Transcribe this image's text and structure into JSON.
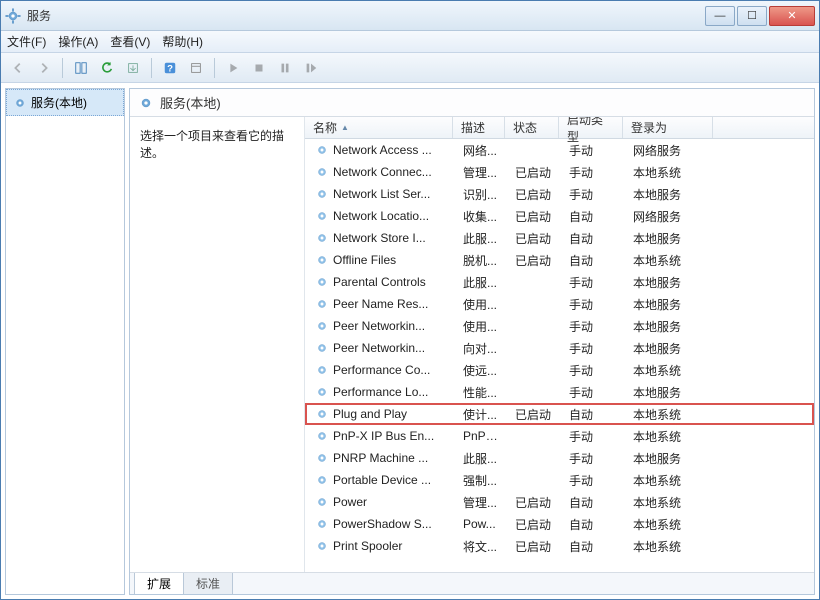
{
  "window": {
    "title": "服务"
  },
  "menu": {
    "file": "文件(F)",
    "action": "操作(A)",
    "view": "查看(V)",
    "help": "帮助(H)"
  },
  "tree": {
    "root": "服务(本地)"
  },
  "pane": {
    "header": "服务(本地)",
    "desc_hint": "选择一个项目来查看它的描述。"
  },
  "columns": {
    "name": "名称",
    "desc": "描述",
    "status": "状态",
    "startup": "启动类型",
    "logon": "登录为"
  },
  "tabs": {
    "extended": "扩展",
    "standard": "标准"
  },
  "services": [
    {
      "name": "Network Access ...",
      "desc": "网络...",
      "status": "",
      "startup": "手动",
      "logon": "网络服务",
      "hl": false
    },
    {
      "name": "Network Connec...",
      "desc": "管理...",
      "status": "已启动",
      "startup": "手动",
      "logon": "本地系统",
      "hl": false
    },
    {
      "name": "Network List Ser...",
      "desc": "识别...",
      "status": "已启动",
      "startup": "手动",
      "logon": "本地服务",
      "hl": false
    },
    {
      "name": "Network Locatio...",
      "desc": "收集...",
      "status": "已启动",
      "startup": "自动",
      "logon": "网络服务",
      "hl": false
    },
    {
      "name": "Network Store I...",
      "desc": "此服...",
      "status": "已启动",
      "startup": "自动",
      "logon": "本地服务",
      "hl": false
    },
    {
      "name": "Offline Files",
      "desc": "脱机...",
      "status": "已启动",
      "startup": "自动",
      "logon": "本地系统",
      "hl": false
    },
    {
      "name": "Parental Controls",
      "desc": "此服...",
      "status": "",
      "startup": "手动",
      "logon": "本地服务",
      "hl": false
    },
    {
      "name": "Peer Name Res...",
      "desc": "使用...",
      "status": "",
      "startup": "手动",
      "logon": "本地服务",
      "hl": false
    },
    {
      "name": "Peer Networkin...",
      "desc": "使用...",
      "status": "",
      "startup": "手动",
      "logon": "本地服务",
      "hl": false
    },
    {
      "name": "Peer Networkin...",
      "desc": "向对...",
      "status": "",
      "startup": "手动",
      "logon": "本地服务",
      "hl": false
    },
    {
      "name": "Performance Co...",
      "desc": "使远...",
      "status": "",
      "startup": "手动",
      "logon": "本地系统",
      "hl": false
    },
    {
      "name": "Performance Lo...",
      "desc": "性能...",
      "status": "",
      "startup": "手动",
      "logon": "本地服务",
      "hl": false
    },
    {
      "name": "Plug and Play",
      "desc": "使计...",
      "status": "已启动",
      "startup": "自动",
      "logon": "本地系统",
      "hl": true
    },
    {
      "name": "PnP-X IP Bus En...",
      "desc": "PnP-...",
      "status": "",
      "startup": "手动",
      "logon": "本地系统",
      "hl": false
    },
    {
      "name": "PNRP Machine ...",
      "desc": "此服...",
      "status": "",
      "startup": "手动",
      "logon": "本地服务",
      "hl": false
    },
    {
      "name": "Portable Device ...",
      "desc": "强制...",
      "status": "",
      "startup": "手动",
      "logon": "本地系统",
      "hl": false
    },
    {
      "name": "Power",
      "desc": "管理...",
      "status": "已启动",
      "startup": "自动",
      "logon": "本地系统",
      "hl": false
    },
    {
      "name": "PowerShadow S...",
      "desc": "Pow...",
      "status": "已启动",
      "startup": "自动",
      "logon": "本地系统",
      "hl": false
    },
    {
      "name": "Print Spooler",
      "desc": "将文...",
      "status": "已启动",
      "startup": "自动",
      "logon": "本地系统",
      "hl": false
    }
  ]
}
